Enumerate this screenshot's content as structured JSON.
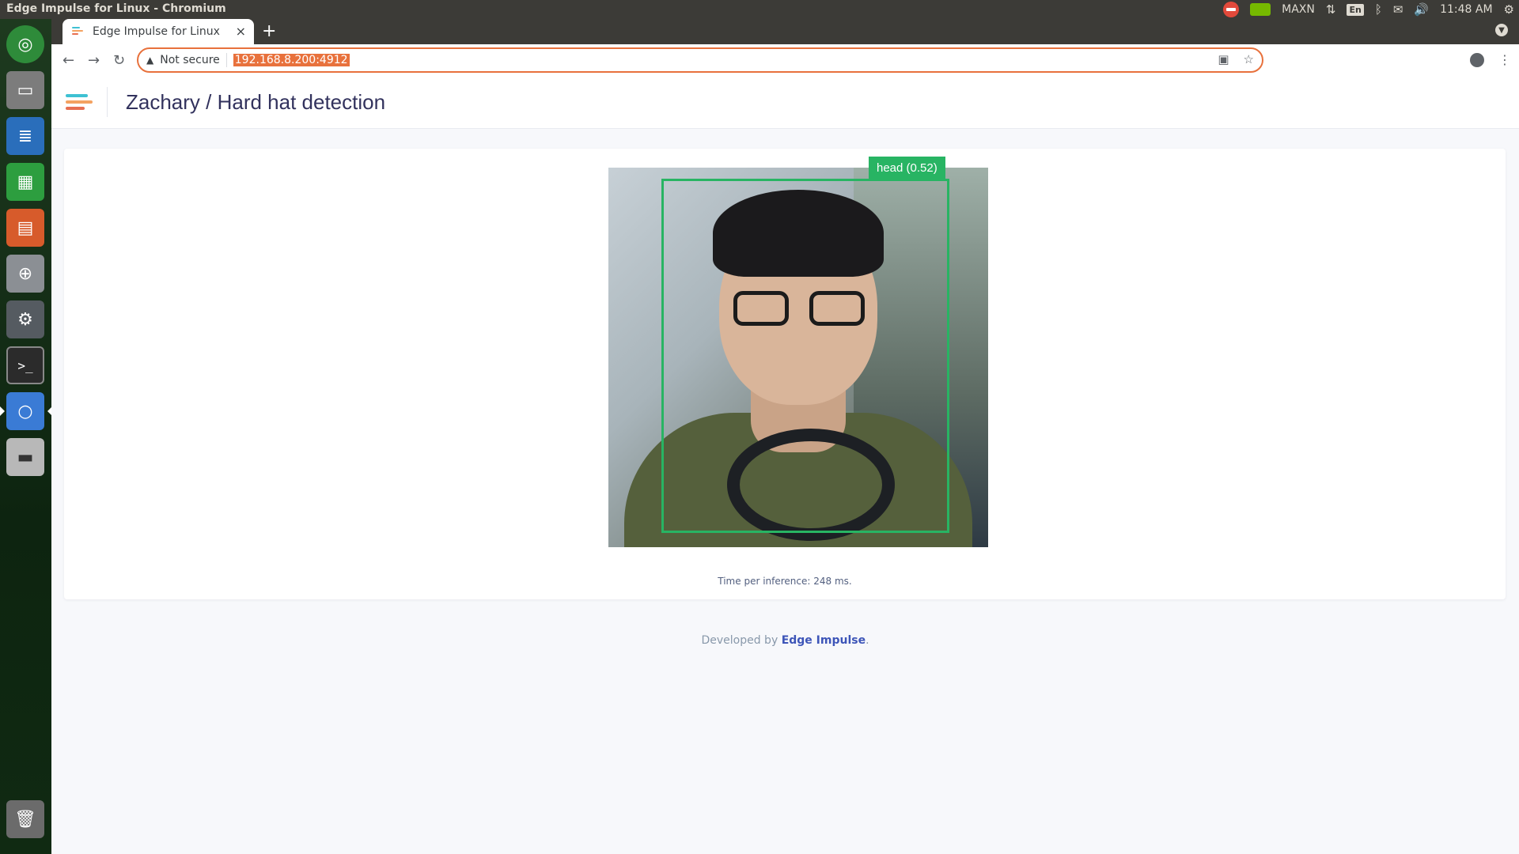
{
  "system_bar": {
    "window_title": "Edge Impulse for Linux - Chromium",
    "power_mode": "MAXN",
    "keyboard_lang": "En",
    "clock": "11:48 AM"
  },
  "launcher": {
    "apps": [
      {
        "name": "ubuntu-dash-icon",
        "color": "#2e8b3a"
      },
      {
        "name": "files-icon",
        "color": "#7c7c7c"
      },
      {
        "name": "writer-icon",
        "color": "#2a6ebb"
      },
      {
        "name": "calc-icon",
        "color": "#2d9e3f"
      },
      {
        "name": "impress-icon",
        "color": "#d75b2b"
      },
      {
        "name": "software-center-icon",
        "color": "#8b8f94"
      },
      {
        "name": "system-settings-icon",
        "color": "#555b61"
      },
      {
        "name": "terminal-icon",
        "color": "#2b2b2b"
      },
      {
        "name": "chromium-icon",
        "color": "#3a7bd5"
      },
      {
        "name": "disk-icon",
        "color": "#b8b8b8"
      },
      {
        "name": "trash-icon",
        "color": "#6b6b6b"
      }
    ]
  },
  "browser": {
    "tab_title": "Edge Impulse for Linux",
    "security_label": "Not secure",
    "url": "192.168.8.200:4912"
  },
  "page": {
    "title": "Zachary / Hard hat detection",
    "detection_label": "head (0.52)",
    "inference_text": "Time per inference: 248 ms.",
    "footer_prefix": "Developed by",
    "footer_link": "Edge Impulse",
    "footer_suffix": "."
  },
  "colors": {
    "accent": "#e8713c",
    "detection": "#28b463",
    "title": "#32325d",
    "link": "#3d55b8"
  }
}
